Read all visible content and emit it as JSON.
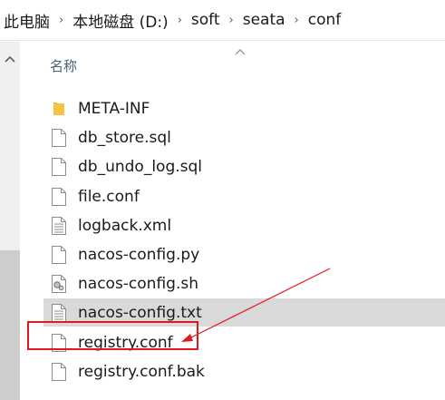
{
  "breadcrumb": {
    "items": [
      "此电脑",
      "本地磁盘 (D:)",
      "soft",
      "seata",
      "conf"
    ],
    "separator": "›"
  },
  "file_list": {
    "column_header": "名称",
    "sort": "ascending",
    "items": [
      {
        "name": "META-INF",
        "type": "folder-icon"
      },
      {
        "name": "db_store.sql",
        "type": "file-icon"
      },
      {
        "name": "db_undo_log.sql",
        "type": "file-icon"
      },
      {
        "name": "file.conf",
        "type": "file-icon"
      },
      {
        "name": "logback.xml",
        "type": "text-file-icon"
      },
      {
        "name": "nacos-config.py",
        "type": "file-icon"
      },
      {
        "name": "nacos-config.sh",
        "type": "script-file-icon"
      },
      {
        "name": "nacos-config.txt",
        "type": "text-file-icon",
        "selected": true
      },
      {
        "name": "registry.conf",
        "type": "file-icon",
        "highlighted": true
      },
      {
        "name": "registry.conf.bak",
        "type": "file-icon"
      }
    ]
  },
  "colors": {
    "annotation": "#e0191e",
    "selection": "#d9d9d9",
    "folder": "#f5c542",
    "header_text": "#4c607a"
  }
}
